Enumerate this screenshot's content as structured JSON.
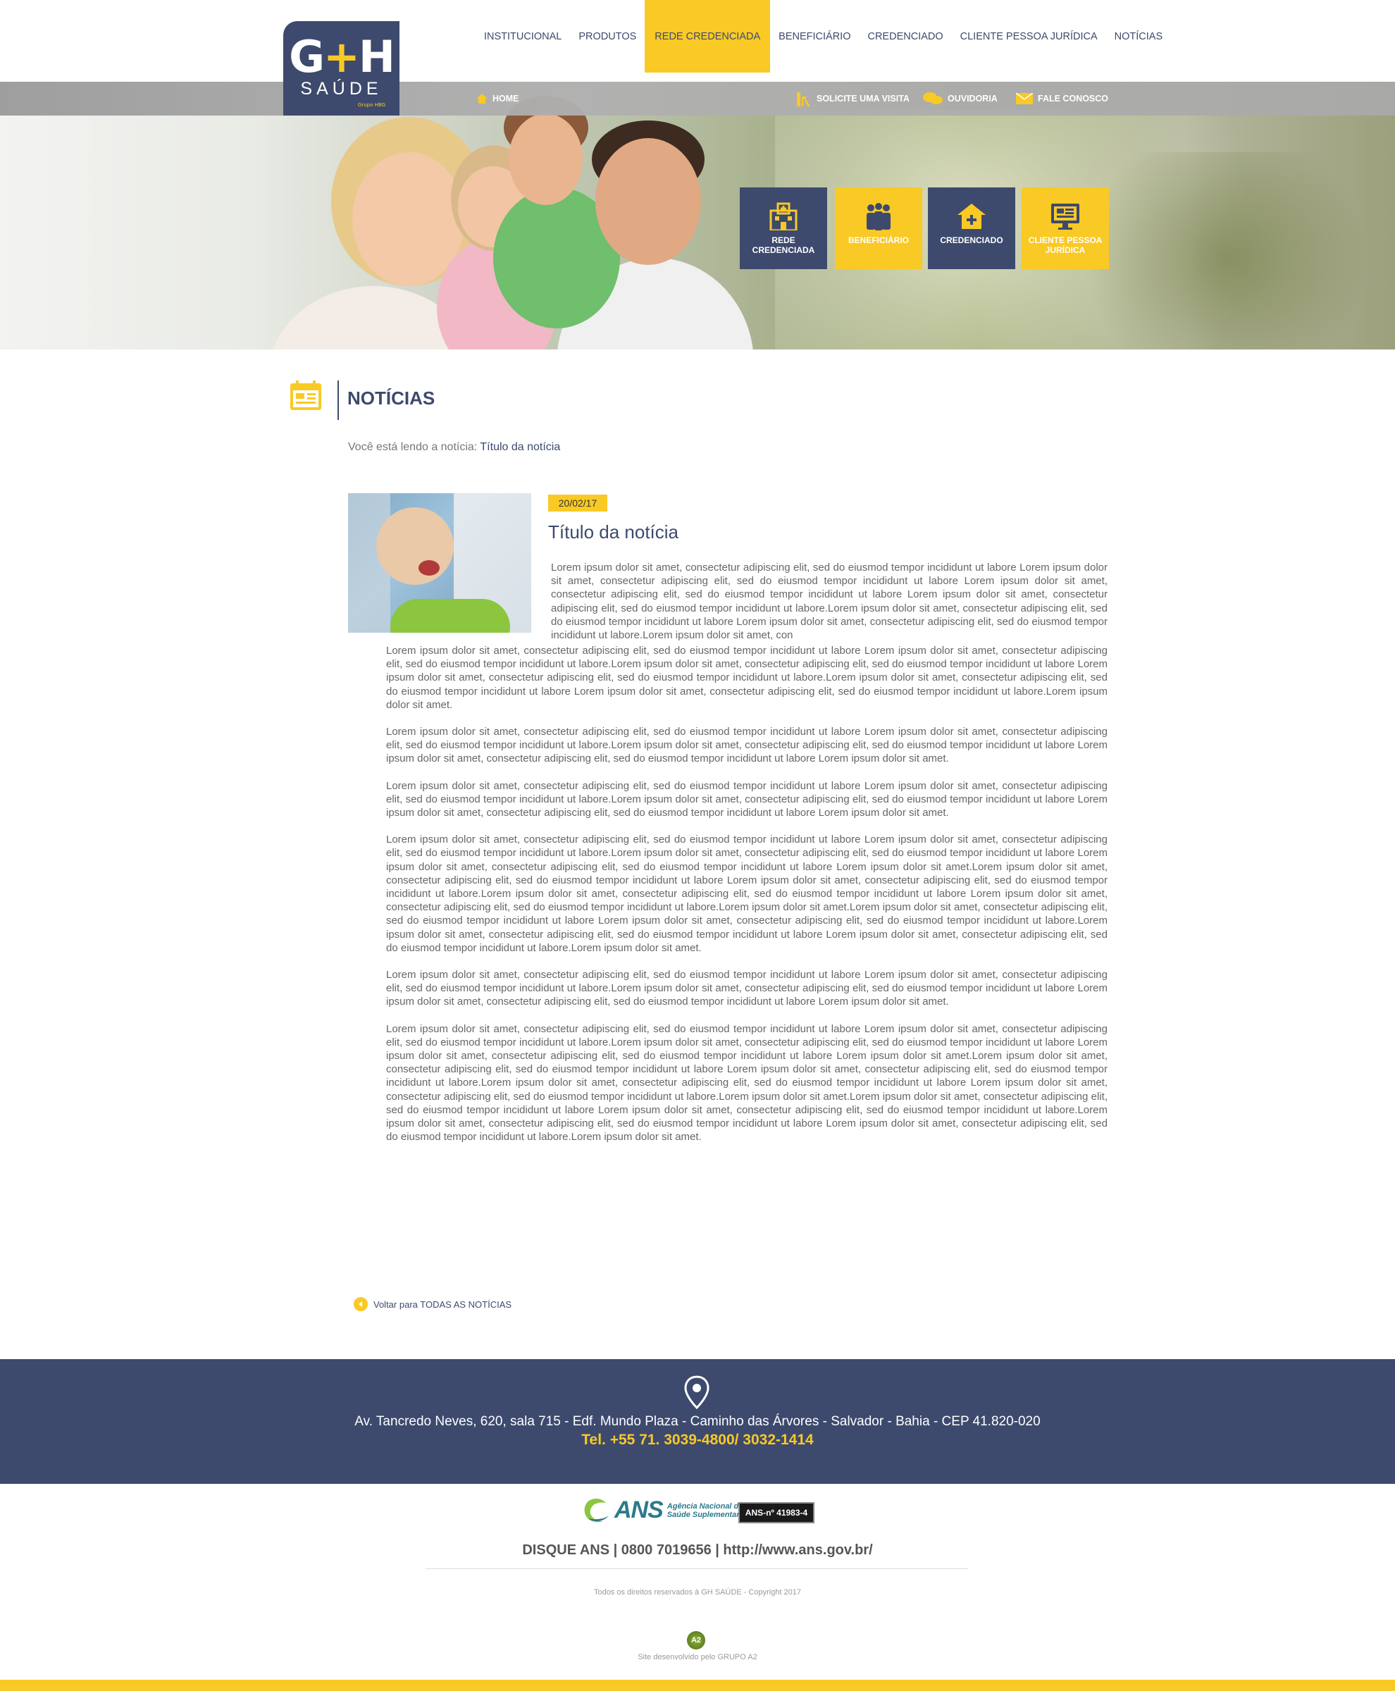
{
  "brand": {
    "logo_main": "GH",
    "logo_sub": "SAÚDE",
    "logo_group": "Grupo HBG"
  },
  "nav": {
    "items": [
      {
        "label": "INSTITUCIONAL"
      },
      {
        "label": "PRODUTOS"
      },
      {
        "label": "REDE CREDENCIADA",
        "active": true
      },
      {
        "label": "BENEFICIÁRIO"
      },
      {
        "label": "CREDENCIADO"
      },
      {
        "label": "CLIENTE PESSOA JURÍDICA"
      },
      {
        "label": "NOTÍCIAS"
      }
    ]
  },
  "subbar": {
    "home": "HOME",
    "visit": "SOLICITE UMA VISITA",
    "ouvidoria": "OUVIDORIA",
    "contact": "FALE CONOSCO"
  },
  "tiles": [
    {
      "label": "REDE CREDENCIADA",
      "icon": "hospital-icon"
    },
    {
      "label": "BENEFICIÁRIO",
      "icon": "people-icon"
    },
    {
      "label": "CREDENCIADO",
      "icon": "house-plus-icon"
    },
    {
      "label": "CLIENTE PESSOA JURÍDICA",
      "icon": "monitor-icon"
    }
  ],
  "section": {
    "title": "NOTÍCIAS",
    "icon": "calendar-icon"
  },
  "breadcrumb": {
    "prefix": "Você está lendo a notícia:",
    "current": "Título da notícia"
  },
  "article": {
    "date": "20/02/17",
    "title": "Título da notícia",
    "first_paragraph": "Lorem ipsum dolor sit amet, consectetur adipiscing elit, sed do eiusmod tempor incididunt ut labore Lorem ipsum dolor sit amet, consectetur adipiscing elit, sed do eiusmod tempor incididunt ut labore Lorem ipsum dolor sit amet, consectetur adipiscing elit, sed do eiusmod tempor incididunt ut labore Lorem ipsum dolor sit amet, consectetur adipiscing elit, sed do eiusmod tempor incididunt ut labore.Lorem ipsum dolor sit amet, consectetur adipiscing elit, sed do eiusmod tempor incididunt ut labore Lorem ipsum dolor sit amet, consectetur adipiscing elit, sed do eiusmod tempor incididunt ut labore.Lorem ipsum dolor sit amet, con",
    "paragraphs": [
      "Lorem ipsum dolor sit amet, consectetur adipiscing elit, sed do eiusmod tempor incididunt ut labore Lorem ipsum dolor sit amet, consectetur adipiscing elit, sed do eiusmod tempor incididunt ut labore.Lorem ipsum dolor sit amet, consectetur adipiscing elit, sed do eiusmod tempor incididunt ut labore Lorem ipsum dolor sit amet, consectetur adipiscing elit, sed do eiusmod tempor incididunt ut labore.Lorem ipsum dolor sit amet, consectetur adipiscing elit, sed do eiusmod tempor incididunt ut labore Lorem ipsum dolor sit amet, consectetur adipiscing elit, sed do eiusmod tempor incididunt ut labore.Lorem ipsum dolor sit amet.",
      "Lorem ipsum dolor sit amet, consectetur adipiscing elit, sed do eiusmod tempor incididunt ut labore Lorem ipsum dolor sit amet, consectetur adipiscing elit, sed do eiusmod tempor incididunt ut labore.Lorem ipsum dolor sit amet, consectetur adipiscing elit, sed do eiusmod tempor incididunt ut labore Lorem ipsum dolor sit amet, consectetur adipiscing elit, sed do eiusmod tempor incididunt ut labore Lorem ipsum dolor sit amet.",
      "Lorem ipsum dolor sit amet, consectetur adipiscing elit, sed do eiusmod tempor incididunt ut labore Lorem ipsum dolor sit amet, consectetur adipiscing elit, sed do eiusmod tempor incididunt ut labore.Lorem ipsum dolor sit amet, consectetur adipiscing elit, sed do eiusmod tempor incididunt ut labore Lorem ipsum dolor sit amet, consectetur adipiscing elit, sed do eiusmod tempor incididunt ut labore Lorem ipsum dolor sit amet.",
      "Lorem ipsum dolor sit amet, consectetur adipiscing elit, sed do eiusmod tempor incididunt ut labore Lorem ipsum dolor sit amet, consectetur adipiscing elit, sed do eiusmod tempor incididunt ut labore.Lorem ipsum dolor sit amet, consectetur adipiscing elit, sed do eiusmod tempor incididunt ut labore Lorem ipsum dolor sit amet, consectetur adipiscing elit, sed do eiusmod tempor incididunt ut labore Lorem ipsum dolor sit amet.Lorem ipsum dolor sit amet, consectetur adipiscing elit, sed do eiusmod tempor incididunt ut labore Lorem ipsum dolor sit amet, consectetur adipiscing elit, sed do eiusmod tempor incididunt ut labore.Lorem ipsum dolor sit amet, consectetur adipiscing elit, sed do eiusmod tempor incididunt ut labore Lorem ipsum dolor sit amet, consectetur adipiscing elit, sed do eiusmod tempor incididunt ut labore.Lorem ipsum dolor sit amet.Lorem ipsum dolor sit amet, consectetur adipiscing elit, sed do eiusmod tempor incididunt ut labore Lorem ipsum dolor sit amet, consectetur adipiscing elit, sed do eiusmod tempor incididunt ut labore.Lorem ipsum dolor sit amet, consectetur adipiscing elit, sed do eiusmod tempor incididunt ut labore Lorem ipsum dolor sit amet, consectetur adipiscing elit, sed do eiusmod tempor incididunt ut labore.Lorem ipsum dolor sit amet.",
      "Lorem ipsum dolor sit amet, consectetur adipiscing elit, sed do eiusmod tempor incididunt ut labore Lorem ipsum dolor sit amet, consectetur adipiscing elit, sed do eiusmod tempor incididunt ut labore.Lorem ipsum dolor sit amet, consectetur adipiscing elit, sed do eiusmod tempor incididunt ut labore Lorem ipsum dolor sit amet, consectetur adipiscing elit, sed do eiusmod tempor incididunt ut labore Lorem ipsum dolor sit amet.",
      "Lorem ipsum dolor sit amet, consectetur adipiscing elit, sed do eiusmod tempor incididunt ut labore Lorem ipsum dolor sit amet, consectetur adipiscing elit, sed do eiusmod tempor incididunt ut labore.Lorem ipsum dolor sit amet, consectetur adipiscing elit, sed do eiusmod tempor incididunt ut labore Lorem ipsum dolor sit amet, consectetur adipiscing elit, sed do eiusmod tempor incididunt ut labore Lorem ipsum dolor sit amet.Lorem ipsum dolor sit amet, consectetur adipiscing elit, sed do eiusmod tempor incididunt ut labore Lorem ipsum dolor sit amet, consectetur adipiscing elit, sed do eiusmod tempor incididunt ut labore.Lorem ipsum dolor sit amet, consectetur adipiscing elit, sed do eiusmod tempor incididunt ut labore Lorem ipsum dolor sit amet, consectetur adipiscing elit, sed do eiusmod tempor incididunt ut labore.Lorem ipsum dolor sit amet.Lorem ipsum dolor sit amet, consectetur adipiscing elit, sed do eiusmod tempor incididunt ut labore Lorem ipsum dolor sit amet, consectetur adipiscing elit, sed do eiusmod tempor incididunt ut labore.Lorem ipsum dolor sit amet, consectetur adipiscing elit, sed do eiusmod tempor incididunt ut labore Lorem ipsum dolor sit amet, consectetur adipiscing elit, sed do eiusmod tempor incididunt ut labore.Lorem ipsum dolor sit amet."
    ]
  },
  "back_link": "Voltar para TODAS AS NOTÍCIAS",
  "footer": {
    "address": "Av. Tancredo Neves, 620, sala 715 - Edf. Mundo Plaza - Caminho das Árvores - Salvador - Bahia - CEP 41.820-020",
    "phone": "Tel. +55 71. 3039-4800/ 3032-1414",
    "ans_logo": "ANS",
    "ans_logo_sub_1": "Agência Nacional de",
    "ans_logo_sub_2": "Saúde Suplementar",
    "ans_badge": "ANS-nº 41983-4",
    "disque": "DISQUE ANS | 0800 7019656 | http://www.ans.gov.br/",
    "rights": "Todos os direitos reservados à GH SAÚDE - Copyright 2017",
    "dev_logo": "A2",
    "dev": "Site desenvolvido pelo GRUPO A2"
  },
  "colors": {
    "navy": "#3d4a6e",
    "yellow": "#f9c925"
  }
}
